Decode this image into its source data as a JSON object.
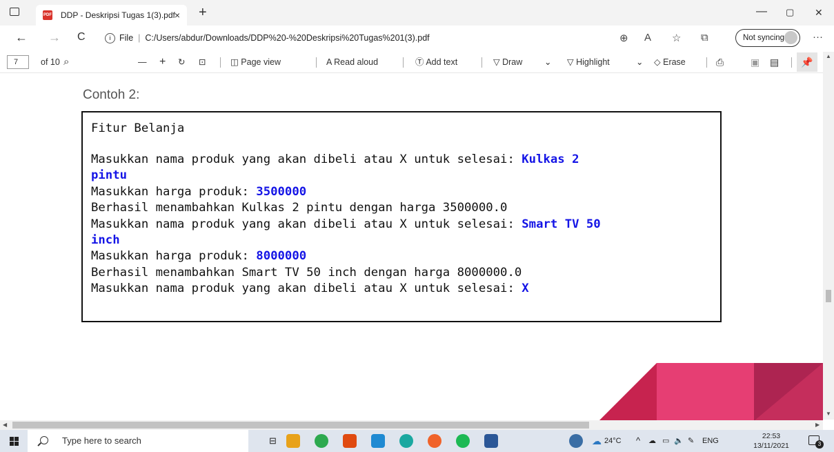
{
  "browser": {
    "tab_title": "DDP - Deskripsi Tugas 1(3).pdf",
    "tab_pdf_badge": "PDF",
    "tab_close": "×",
    "new_tab": "+",
    "window_min": "—",
    "window_max": "▢",
    "window_close": "✕"
  },
  "address_bar": {
    "back": "←",
    "forward": "→",
    "refresh": "C",
    "info_glyph": "i",
    "scheme_label": "File",
    "url": "C:/Users/abdur/Downloads/DDP%20-%20Deskripsi%20Tugas%201(3).pdf",
    "zoom_icon": "⊕",
    "read_aloud_icon": "A",
    "favorites_icon": "☆",
    "collections_icon": "⧉",
    "sync_label": "Not syncing",
    "more": "···"
  },
  "pdf_toolbar": {
    "page_number": "7",
    "page_total": "of 10",
    "search_icon": "⌕",
    "zoom_out": "—",
    "zoom_in": "+",
    "rotate": "↻",
    "fit": "⊡",
    "page_view_icon": "◫",
    "page_view": "Page view",
    "read_aloud_icon": "A",
    "read_aloud": "Read aloud",
    "add_text_icon": "Ⓣ",
    "add_text": "Add text",
    "draw_icon": "▽",
    "draw": "Draw",
    "draw_chevron": "⌄",
    "highlight_icon": "▽",
    "highlight": "Highlight",
    "highlight_chevron": "⌄",
    "erase_icon": "◇",
    "erase": "Erase",
    "print_icon": "⎙",
    "save_icon": "▣",
    "save_as_icon": "▤",
    "pin_icon": "📌"
  },
  "document": {
    "heading": "Contoh 2:",
    "console": [
      {
        "parts": [
          {
            "t": "Fitur Belanja",
            "input": false
          }
        ]
      },
      {
        "parts": [
          {
            "t": "Masukkan nama produk yang akan dibeli atau X untuk selesai: ",
            "input": false
          },
          {
            "t": "Kulkas 2",
            "input": true
          }
        ]
      },
      {
        "parts": [
          {
            "t": "pintu",
            "input": true
          }
        ]
      },
      {
        "parts": [
          {
            "t": "Masukkan harga produk: ",
            "input": false
          },
          {
            "t": "3500000",
            "input": true
          }
        ]
      },
      {
        "parts": [
          {
            "t": "Berhasil menambahkan Kulkas 2 pintu dengan harga 3500000.0",
            "input": false
          }
        ]
      },
      {
        "parts": [
          {
            "t": "Masukkan nama produk yang akan dibeli atau X untuk selesai: ",
            "input": false
          },
          {
            "t": "Smart TV 50",
            "input": true
          }
        ]
      },
      {
        "parts": [
          {
            "t": "inch",
            "input": true
          }
        ]
      },
      {
        "parts": [
          {
            "t": "Masukkan harga produk: ",
            "input": false
          },
          {
            "t": "8000000",
            "input": true
          }
        ]
      },
      {
        "parts": [
          {
            "t": "Berhasil menambahkan Smart TV 50 inch dengan harga 8000000.0",
            "input": false
          }
        ]
      },
      {
        "parts": [
          {
            "t": "Masukkan nama produk yang akan dibeli atau X untuk selesai: ",
            "input": false
          },
          {
            "t": "X",
            "input": true
          }
        ]
      }
    ],
    "input_color": "#1414e6"
  },
  "taskbar": {
    "search_placeholder": "Type here to search",
    "task_view": "⊟",
    "weather": "24°C",
    "tray_chevron": "^",
    "language": "ENG",
    "time": "22:53",
    "date": "13/11/2021",
    "notification_count": "3"
  }
}
